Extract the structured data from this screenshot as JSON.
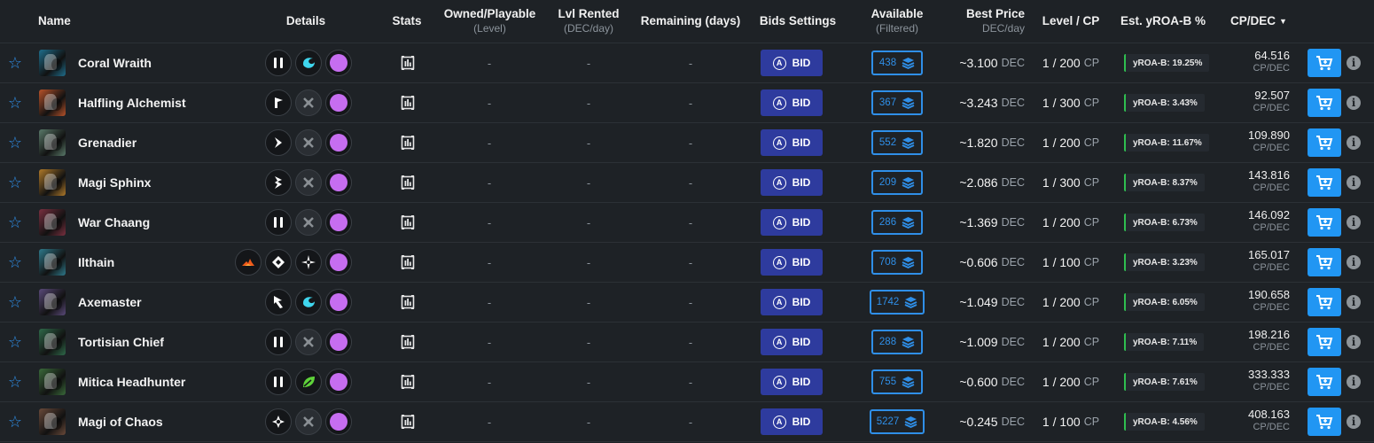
{
  "header": {
    "name": "Name",
    "details": "Details",
    "stats": "Stats",
    "owned": "Owned/Playable",
    "owned_sub": "(Level)",
    "lvl_rented": "Lvl Rented",
    "lvl_rented_sub": "(DEC/day)",
    "remaining": "Remaining (days)",
    "bids_settings": "Bids Settings",
    "available": "Available",
    "available_sub": "(Filtered)",
    "best_price": "Best Price",
    "best_price_sub": "DEC/day",
    "level_cp": "Level / CP",
    "yroa": "Est. yROA-B %",
    "cpdec": "CP/DEC"
  },
  "colors": {
    "background": "#1e2226",
    "accent_blue": "#2f8fe8",
    "bid_button": "#2e3b9e",
    "buy_button": "#2196f3",
    "yroa_bar": "#2fbf50",
    "mana_purple": "#c66df0"
  },
  "labels": {
    "dash": "-",
    "bid": "BID",
    "dec_unit": "DEC",
    "cp_unit": "CP",
    "cpdec_unit": "CP/DEC",
    "tilde": "~"
  },
  "rows": [
    {
      "name": "Coral Wraith",
      "thumb_color": "#1f6e8c",
      "abilities": [
        "sneak-icon",
        "swim-icon"
      ],
      "available": "438",
      "price": "3.100",
      "level": "1 / 200",
      "yroa": "yROA-B: 19.25%",
      "cpdec": "64.516"
    },
    {
      "name": "Halfling Alchemist",
      "thumb_color": "#b8532a",
      "abilities": [
        "piercing-icon",
        "empty-icon"
      ],
      "available": "367",
      "price": "3.243",
      "level": "1 / 300",
      "yroa": "yROA-B: 3.43%",
      "cpdec": "92.507"
    },
    {
      "name": "Grenadier",
      "thumb_color": "#5a7a6a",
      "abilities": [
        "blast-icon",
        "empty-icon"
      ],
      "available": "552",
      "price": "1.820",
      "level": "1 / 200",
      "yroa": "yROA-B: 11.67%",
      "cpdec": "109.890"
    },
    {
      "name": "Magi Sphinx",
      "thumb_color": "#b07a2a",
      "abilities": [
        "double-strike-icon",
        "empty-icon"
      ],
      "available": "209",
      "price": "2.086",
      "level": "1 / 300",
      "yroa": "yROA-B: 8.37%",
      "cpdec": "143.816"
    },
    {
      "name": "War Chaang",
      "thumb_color": "#7a3040",
      "abilities": [
        "sneak-icon",
        "empty-icon"
      ],
      "available": "286",
      "price": "1.369",
      "level": "1 / 200",
      "yroa": "yROA-B: 6.73%",
      "cpdec": "146.092"
    },
    {
      "name": "Ilthain",
      "thumb_color": "#2f7a8c",
      "abilities": [
        "fire-icon",
        "diamond-icon",
        "star-icon"
      ],
      "available": "708",
      "price": "0.606",
      "level": "1 / 100",
      "yroa": "yROA-B: 3.23%",
      "cpdec": "165.017"
    },
    {
      "name": "Axemaster",
      "thumb_color": "#5a4a7a",
      "abilities": [
        "reach-icon",
        "swim-icon"
      ],
      "available": "1742",
      "price": "1.049",
      "level": "1 / 200",
      "yroa": "yROA-B: 6.05%",
      "cpdec": "190.658"
    },
    {
      "name": "Tortisian Chief",
      "thumb_color": "#2f6a4a",
      "abilities": [
        "sneak-icon",
        "empty-icon"
      ],
      "available": "288",
      "price": "1.009",
      "level": "1 / 200",
      "yroa": "yROA-B: 7.11%",
      "cpdec": "198.216"
    },
    {
      "name": "Mitica Headhunter",
      "thumb_color": "#3a6a3a",
      "abilities": [
        "sneak-icon",
        "leaf-icon"
      ],
      "available": "755",
      "price": "0.600",
      "level": "1 / 200",
      "yroa": "yROA-B: 7.61%",
      "cpdec": "333.333"
    },
    {
      "name": "Magi of Chaos",
      "thumb_color": "#6a4a3a",
      "abilities": [
        "shatter-icon",
        "empty-icon"
      ],
      "available": "5227",
      "price": "0.245",
      "level": "1 / 100",
      "yroa": "yROA-B: 4.56%",
      "cpdec": "408.163"
    }
  ]
}
